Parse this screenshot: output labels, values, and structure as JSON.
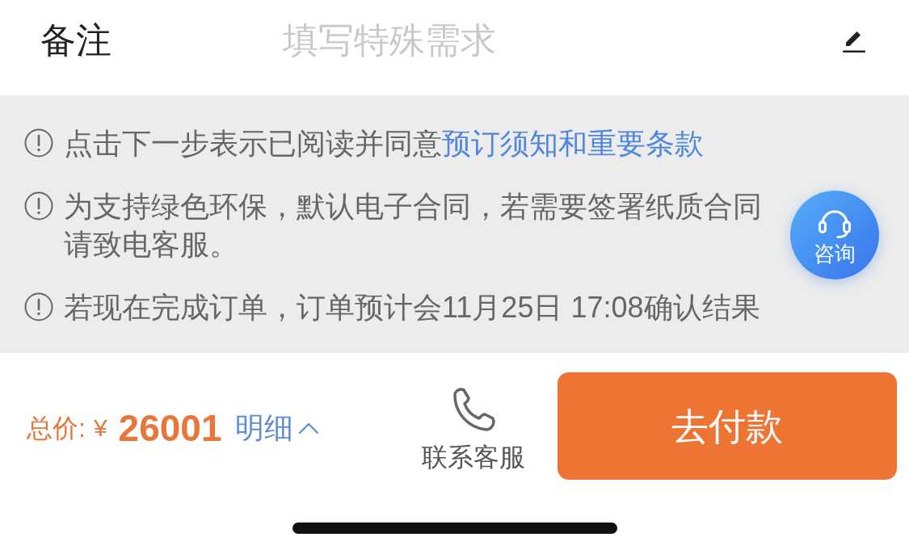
{
  "remark": {
    "label": "备注",
    "placeholder": "填写特殊需求"
  },
  "notices": [
    {
      "text": "点击下一步表示已阅读并同意",
      "link": "预订须知和重要条款"
    },
    {
      "text": "为支持绿色环保，默认电子合同，若需要签署纸质合同请致电客服。"
    },
    {
      "text": "若现在完成订单，订单预计会11月25日 17:08确认结果"
    }
  ],
  "consult_button": {
    "label": "咨询"
  },
  "footer": {
    "total_label": "总价:",
    "currency": "¥",
    "amount": "26001",
    "details_link": {
      "label": "明细"
    },
    "contact_button": {
      "label": "联系客服"
    },
    "pay_button": {
      "label": "去付款"
    }
  }
}
